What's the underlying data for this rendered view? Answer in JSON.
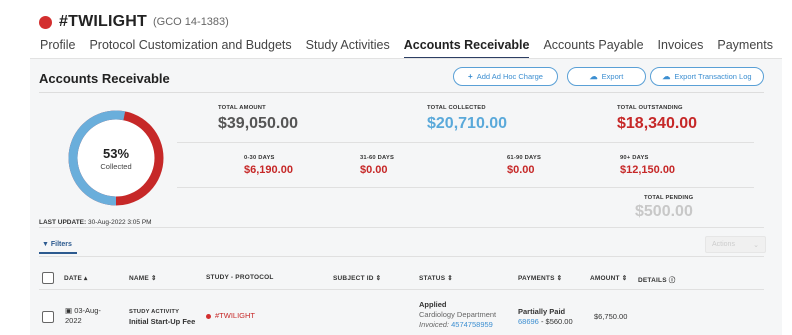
{
  "header": {
    "study_name": "#TWILIGHT",
    "study_code": "(GCO 14-1383)"
  },
  "tabs": [
    {
      "label": "Profile",
      "active": false
    },
    {
      "label": "Protocol Customization and Budgets",
      "active": false
    },
    {
      "label": "Study Activities",
      "active": false
    },
    {
      "label": "Accounts Receivable",
      "active": true
    },
    {
      "label": "Accounts Payable",
      "active": false
    },
    {
      "label": "Invoices",
      "active": false
    },
    {
      "label": "Payments",
      "active": false
    }
  ],
  "section": {
    "title": "Accounts Receivable",
    "buttons": {
      "add_charge": "Add Ad Hoc Charge",
      "export": "Export",
      "export_log": "Export Transaction Log"
    }
  },
  "donut": {
    "percent": "53%",
    "label": "Collected",
    "collected_fraction": 0.53
  },
  "last_update": {
    "label": "LAST UPDATE:",
    "value": "30-Aug-2022 3:05 PM"
  },
  "totals": {
    "total_amount_label": "TOTAL AMOUNT",
    "total_amount": "$39,050.00",
    "total_collected_label": "TOTAL COLLECTED",
    "total_collected": "$20,710.00",
    "total_outstanding_label": "TOTAL OUTSTANDING",
    "total_outstanding": "$18,340.00",
    "d0_30_label": "0-30 DAYS",
    "d0_30": "$6,190.00",
    "d31_60_label": "31-60 DAYS",
    "d31_60": "$0.00",
    "d61_90_label": "61-90 DAYS",
    "d61_90": "$0.00",
    "d90_label": "90+ DAYS",
    "d90": "$12,150.00",
    "pending_label": "TOTAL PENDING",
    "pending": "$500.00"
  },
  "toolbar": {
    "filters": "Filters",
    "actions": "Actions"
  },
  "table": {
    "headers": {
      "date": "DATE",
      "name": "NAME",
      "study": "STUDY - PROTOCOL",
      "subject": "SUBJECT ID",
      "status": "STATUS",
      "payments": "PAYMENTS",
      "amount": "AMOUNT",
      "details": "DETAILS"
    },
    "rows": [
      {
        "date_line1": "03-Aug-",
        "date_line2": "2022",
        "name_type": "STUDY ACTIVITY",
        "name": "Initial Start-Up Fee",
        "study": "#TWILIGHT",
        "status": "Applied",
        "status_dept": "Cardiology Department",
        "invoiced_label": "Invoiced:",
        "invoiced_num": "4574758959",
        "payment_status": "Partially Paid",
        "payment_ref": "68696",
        "payment_amount": "- $560.00",
        "amount": "$6,750.00"
      }
    ]
  },
  "colors": {
    "collected": "#6aaedb",
    "outstanding": "#c62828",
    "accent": "#2c3e63"
  }
}
